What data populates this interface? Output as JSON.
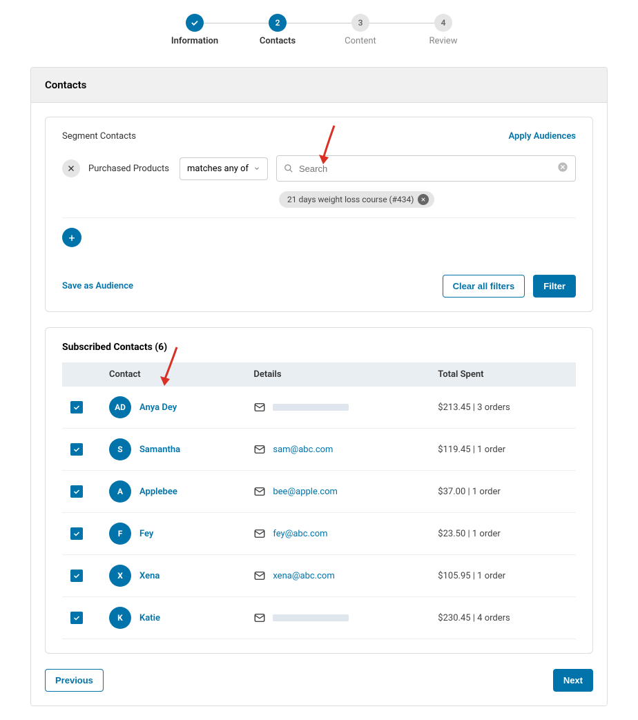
{
  "stepper": [
    {
      "label": "Information",
      "state": "done"
    },
    {
      "label": "Contacts",
      "state": "active",
      "num": "2"
    },
    {
      "label": "Content",
      "state": "todo",
      "num": "3"
    },
    {
      "label": "Review",
      "state": "todo",
      "num": "4"
    }
  ],
  "panel_title": "Contacts",
  "segment": {
    "title": "Segment Contacts",
    "apply_link": "Apply Audiences",
    "filter_label": "Purchased Products",
    "match_option": "matches any of",
    "search_placeholder": "Search",
    "chip": "21 days weight loss course (#434)",
    "save_audience": "Save as Audience",
    "clear_filters": "Clear all filters",
    "filter_btn": "Filter"
  },
  "contacts_title": "Subscribed Contacts (6)",
  "headers": {
    "contact": "Contact",
    "details": "Details",
    "spent": "Total Spent"
  },
  "contacts": [
    {
      "initials": "AD",
      "name": "Anya Dey",
      "email": "",
      "blurred": true,
      "spent": "$213.45 | 3 orders"
    },
    {
      "initials": "S",
      "name": "Samantha",
      "email": "sam@abc.com",
      "blurred": false,
      "spent": "$119.45 | 1 order"
    },
    {
      "initials": "A",
      "name": "Applebee",
      "email": "bee@apple.com",
      "blurred": false,
      "spent": "$37.00 | 1 order"
    },
    {
      "initials": "F",
      "name": "Fey",
      "email": "fey@abc.com",
      "blurred": false,
      "spent": "$23.50 | 1 order"
    },
    {
      "initials": "X",
      "name": "Xena",
      "email": "xena@abc.com",
      "blurred": false,
      "spent": "$105.95 | 1 order"
    },
    {
      "initials": "K",
      "name": "Katie",
      "email": "",
      "blurred": true,
      "spent": "$230.45 | 4 orders"
    }
  ],
  "nav": {
    "prev": "Previous",
    "next": "Next"
  }
}
